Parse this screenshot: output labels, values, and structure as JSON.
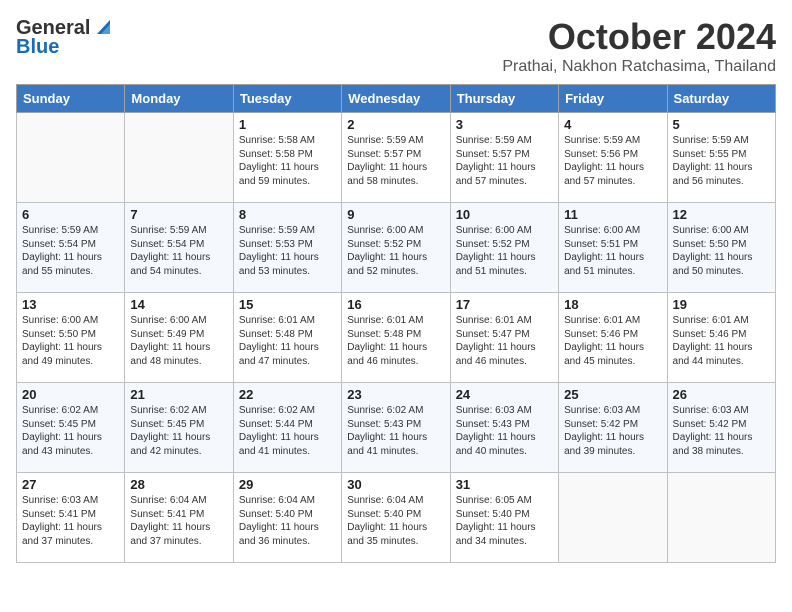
{
  "header": {
    "logo_general": "General",
    "logo_blue": "Blue",
    "month": "October 2024",
    "location": "Prathai, Nakhon Ratchasima, Thailand"
  },
  "weekdays": [
    "Sunday",
    "Monday",
    "Tuesday",
    "Wednesday",
    "Thursday",
    "Friday",
    "Saturday"
  ],
  "weeks": [
    [
      {
        "day": null
      },
      {
        "day": null
      },
      {
        "day": "1",
        "sunrise": "Sunrise: 5:58 AM",
        "sunset": "Sunset: 5:58 PM",
        "daylight": "Daylight: 11 hours and 59 minutes."
      },
      {
        "day": "2",
        "sunrise": "Sunrise: 5:59 AM",
        "sunset": "Sunset: 5:57 PM",
        "daylight": "Daylight: 11 hours and 58 minutes."
      },
      {
        "day": "3",
        "sunrise": "Sunrise: 5:59 AM",
        "sunset": "Sunset: 5:57 PM",
        "daylight": "Daylight: 11 hours and 57 minutes."
      },
      {
        "day": "4",
        "sunrise": "Sunrise: 5:59 AM",
        "sunset": "Sunset: 5:56 PM",
        "daylight": "Daylight: 11 hours and 57 minutes."
      },
      {
        "day": "5",
        "sunrise": "Sunrise: 5:59 AM",
        "sunset": "Sunset: 5:55 PM",
        "daylight": "Daylight: 11 hours and 56 minutes."
      }
    ],
    [
      {
        "day": "6",
        "sunrise": "Sunrise: 5:59 AM",
        "sunset": "Sunset: 5:54 PM",
        "daylight": "Daylight: 11 hours and 55 minutes."
      },
      {
        "day": "7",
        "sunrise": "Sunrise: 5:59 AM",
        "sunset": "Sunset: 5:54 PM",
        "daylight": "Daylight: 11 hours and 54 minutes."
      },
      {
        "day": "8",
        "sunrise": "Sunrise: 5:59 AM",
        "sunset": "Sunset: 5:53 PM",
        "daylight": "Daylight: 11 hours and 53 minutes."
      },
      {
        "day": "9",
        "sunrise": "Sunrise: 6:00 AM",
        "sunset": "Sunset: 5:52 PM",
        "daylight": "Daylight: 11 hours and 52 minutes."
      },
      {
        "day": "10",
        "sunrise": "Sunrise: 6:00 AM",
        "sunset": "Sunset: 5:52 PM",
        "daylight": "Daylight: 11 hours and 51 minutes."
      },
      {
        "day": "11",
        "sunrise": "Sunrise: 6:00 AM",
        "sunset": "Sunset: 5:51 PM",
        "daylight": "Daylight: 11 hours and 51 minutes."
      },
      {
        "day": "12",
        "sunrise": "Sunrise: 6:00 AM",
        "sunset": "Sunset: 5:50 PM",
        "daylight": "Daylight: 11 hours and 50 minutes."
      }
    ],
    [
      {
        "day": "13",
        "sunrise": "Sunrise: 6:00 AM",
        "sunset": "Sunset: 5:50 PM",
        "daylight": "Daylight: 11 hours and 49 minutes."
      },
      {
        "day": "14",
        "sunrise": "Sunrise: 6:00 AM",
        "sunset": "Sunset: 5:49 PM",
        "daylight": "Daylight: 11 hours and 48 minutes."
      },
      {
        "day": "15",
        "sunrise": "Sunrise: 6:01 AM",
        "sunset": "Sunset: 5:48 PM",
        "daylight": "Daylight: 11 hours and 47 minutes."
      },
      {
        "day": "16",
        "sunrise": "Sunrise: 6:01 AM",
        "sunset": "Sunset: 5:48 PM",
        "daylight": "Daylight: 11 hours and 46 minutes."
      },
      {
        "day": "17",
        "sunrise": "Sunrise: 6:01 AM",
        "sunset": "Sunset: 5:47 PM",
        "daylight": "Daylight: 11 hours and 46 minutes."
      },
      {
        "day": "18",
        "sunrise": "Sunrise: 6:01 AM",
        "sunset": "Sunset: 5:46 PM",
        "daylight": "Daylight: 11 hours and 45 minutes."
      },
      {
        "day": "19",
        "sunrise": "Sunrise: 6:01 AM",
        "sunset": "Sunset: 5:46 PM",
        "daylight": "Daylight: 11 hours and 44 minutes."
      }
    ],
    [
      {
        "day": "20",
        "sunrise": "Sunrise: 6:02 AM",
        "sunset": "Sunset: 5:45 PM",
        "daylight": "Daylight: 11 hours and 43 minutes."
      },
      {
        "day": "21",
        "sunrise": "Sunrise: 6:02 AM",
        "sunset": "Sunset: 5:45 PM",
        "daylight": "Daylight: 11 hours and 42 minutes."
      },
      {
        "day": "22",
        "sunrise": "Sunrise: 6:02 AM",
        "sunset": "Sunset: 5:44 PM",
        "daylight": "Daylight: 11 hours and 41 minutes."
      },
      {
        "day": "23",
        "sunrise": "Sunrise: 6:02 AM",
        "sunset": "Sunset: 5:43 PM",
        "daylight": "Daylight: 11 hours and 41 minutes."
      },
      {
        "day": "24",
        "sunrise": "Sunrise: 6:03 AM",
        "sunset": "Sunset: 5:43 PM",
        "daylight": "Daylight: 11 hours and 40 minutes."
      },
      {
        "day": "25",
        "sunrise": "Sunrise: 6:03 AM",
        "sunset": "Sunset: 5:42 PM",
        "daylight": "Daylight: 11 hours and 39 minutes."
      },
      {
        "day": "26",
        "sunrise": "Sunrise: 6:03 AM",
        "sunset": "Sunset: 5:42 PM",
        "daylight": "Daylight: 11 hours and 38 minutes."
      }
    ],
    [
      {
        "day": "27",
        "sunrise": "Sunrise: 6:03 AM",
        "sunset": "Sunset: 5:41 PM",
        "daylight": "Daylight: 11 hours and 37 minutes."
      },
      {
        "day": "28",
        "sunrise": "Sunrise: 6:04 AM",
        "sunset": "Sunset: 5:41 PM",
        "daylight": "Daylight: 11 hours and 37 minutes."
      },
      {
        "day": "29",
        "sunrise": "Sunrise: 6:04 AM",
        "sunset": "Sunset: 5:40 PM",
        "daylight": "Daylight: 11 hours and 36 minutes."
      },
      {
        "day": "30",
        "sunrise": "Sunrise: 6:04 AM",
        "sunset": "Sunset: 5:40 PM",
        "daylight": "Daylight: 11 hours and 35 minutes."
      },
      {
        "day": "31",
        "sunrise": "Sunrise: 6:05 AM",
        "sunset": "Sunset: 5:40 PM",
        "daylight": "Daylight: 11 hours and 34 minutes."
      },
      {
        "day": null
      },
      {
        "day": null
      }
    ]
  ]
}
